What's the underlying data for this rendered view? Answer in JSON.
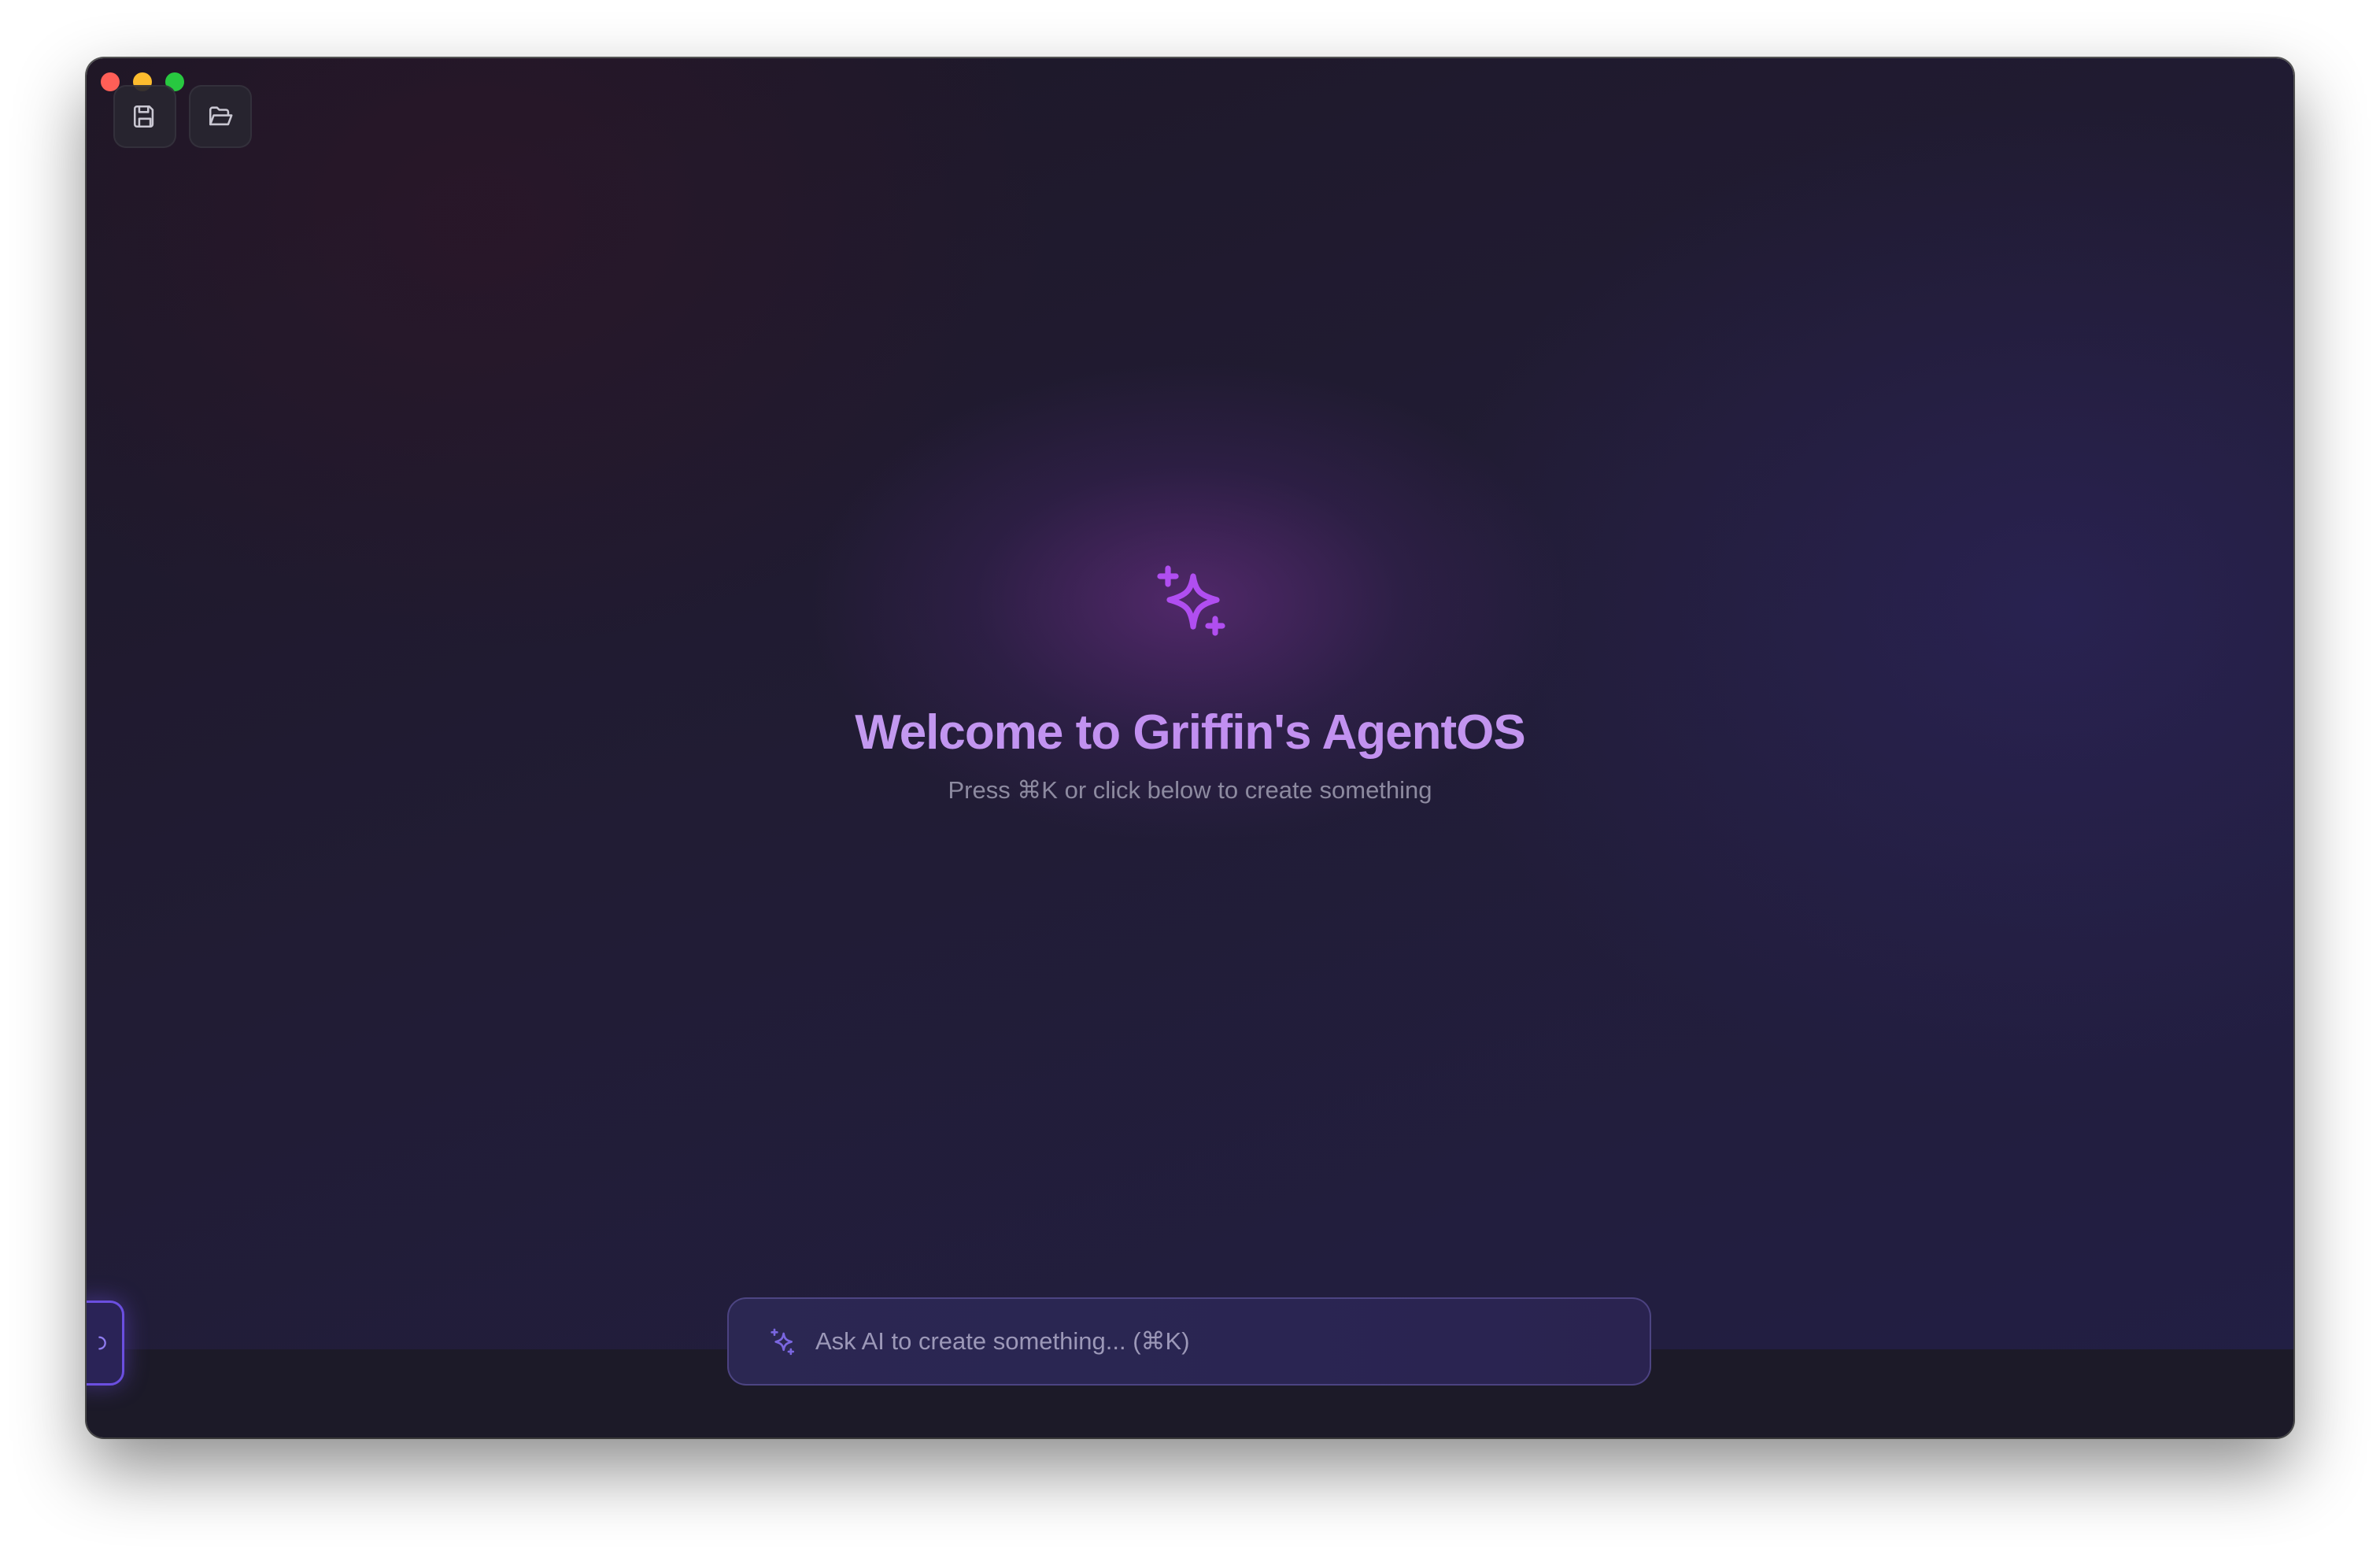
{
  "window": {
    "controls": [
      "close",
      "minimize",
      "maximize"
    ]
  },
  "toolbar": {
    "buttons": [
      {
        "icon": "save-icon",
        "label": "Save"
      },
      {
        "icon": "folder-open-icon",
        "label": "Open"
      }
    ]
  },
  "hero": {
    "icon": "sparkles-icon",
    "title": "Welcome to Griffin's AgentOS",
    "subtitle": "Press ⌘K or click below to create something"
  },
  "ask_bar": {
    "icon": "sparkles-icon",
    "placeholder": "Ask AI to create something... (⌘K)"
  },
  "side_tab": {
    "icon": "chevron-icon"
  },
  "colors": {
    "accent": "#a855f7",
    "title_gradient_start": "#c7b3ef",
    "title_gradient_end": "#c18ef0",
    "ask_bar_border": "#6b4fe0",
    "background": "#211c34"
  }
}
